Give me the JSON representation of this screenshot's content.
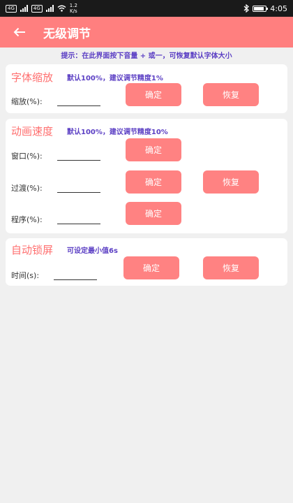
{
  "statusbar": {
    "sim1": "4G",
    "sim2": "4G",
    "net_speed_value": "1.2",
    "net_speed_unit": "K/s",
    "bluetooth_icon": "bluetooth-icon",
    "battery_level": 0.85,
    "time": "4:05"
  },
  "appbar": {
    "back_icon": "arrow-left-icon",
    "title": "无级调节"
  },
  "hint": "提示：在此界面按下音量 + 或一，可恢复默认字体大小",
  "sections": {
    "font": {
      "title": "字体缩放",
      "note": "默认100%，建议调节精度1%",
      "fields": [
        {
          "label": "缩放(%):",
          "value": ""
        }
      ]
    },
    "animation": {
      "title": "动画速度",
      "note": "默认100%，建议调节精度10%",
      "fields": [
        {
          "label": "窗口(%):",
          "value": ""
        },
        {
          "label": "过渡(%):",
          "value": ""
        },
        {
          "label": "程序(%):",
          "value": ""
        }
      ]
    },
    "lock": {
      "title": "自动锁屏",
      "note": "可设定最小值6s",
      "fields": [
        {
          "label": "时间(s):",
          "value": ""
        }
      ]
    }
  },
  "buttons": {
    "confirm": "确定",
    "restore": "恢复"
  },
  "colors": {
    "accent": "#ff7f7f",
    "button": "#ff8282",
    "note": "#5b3fc4",
    "section_title": "#ff6f6f",
    "background": "#f0f0f0"
  }
}
